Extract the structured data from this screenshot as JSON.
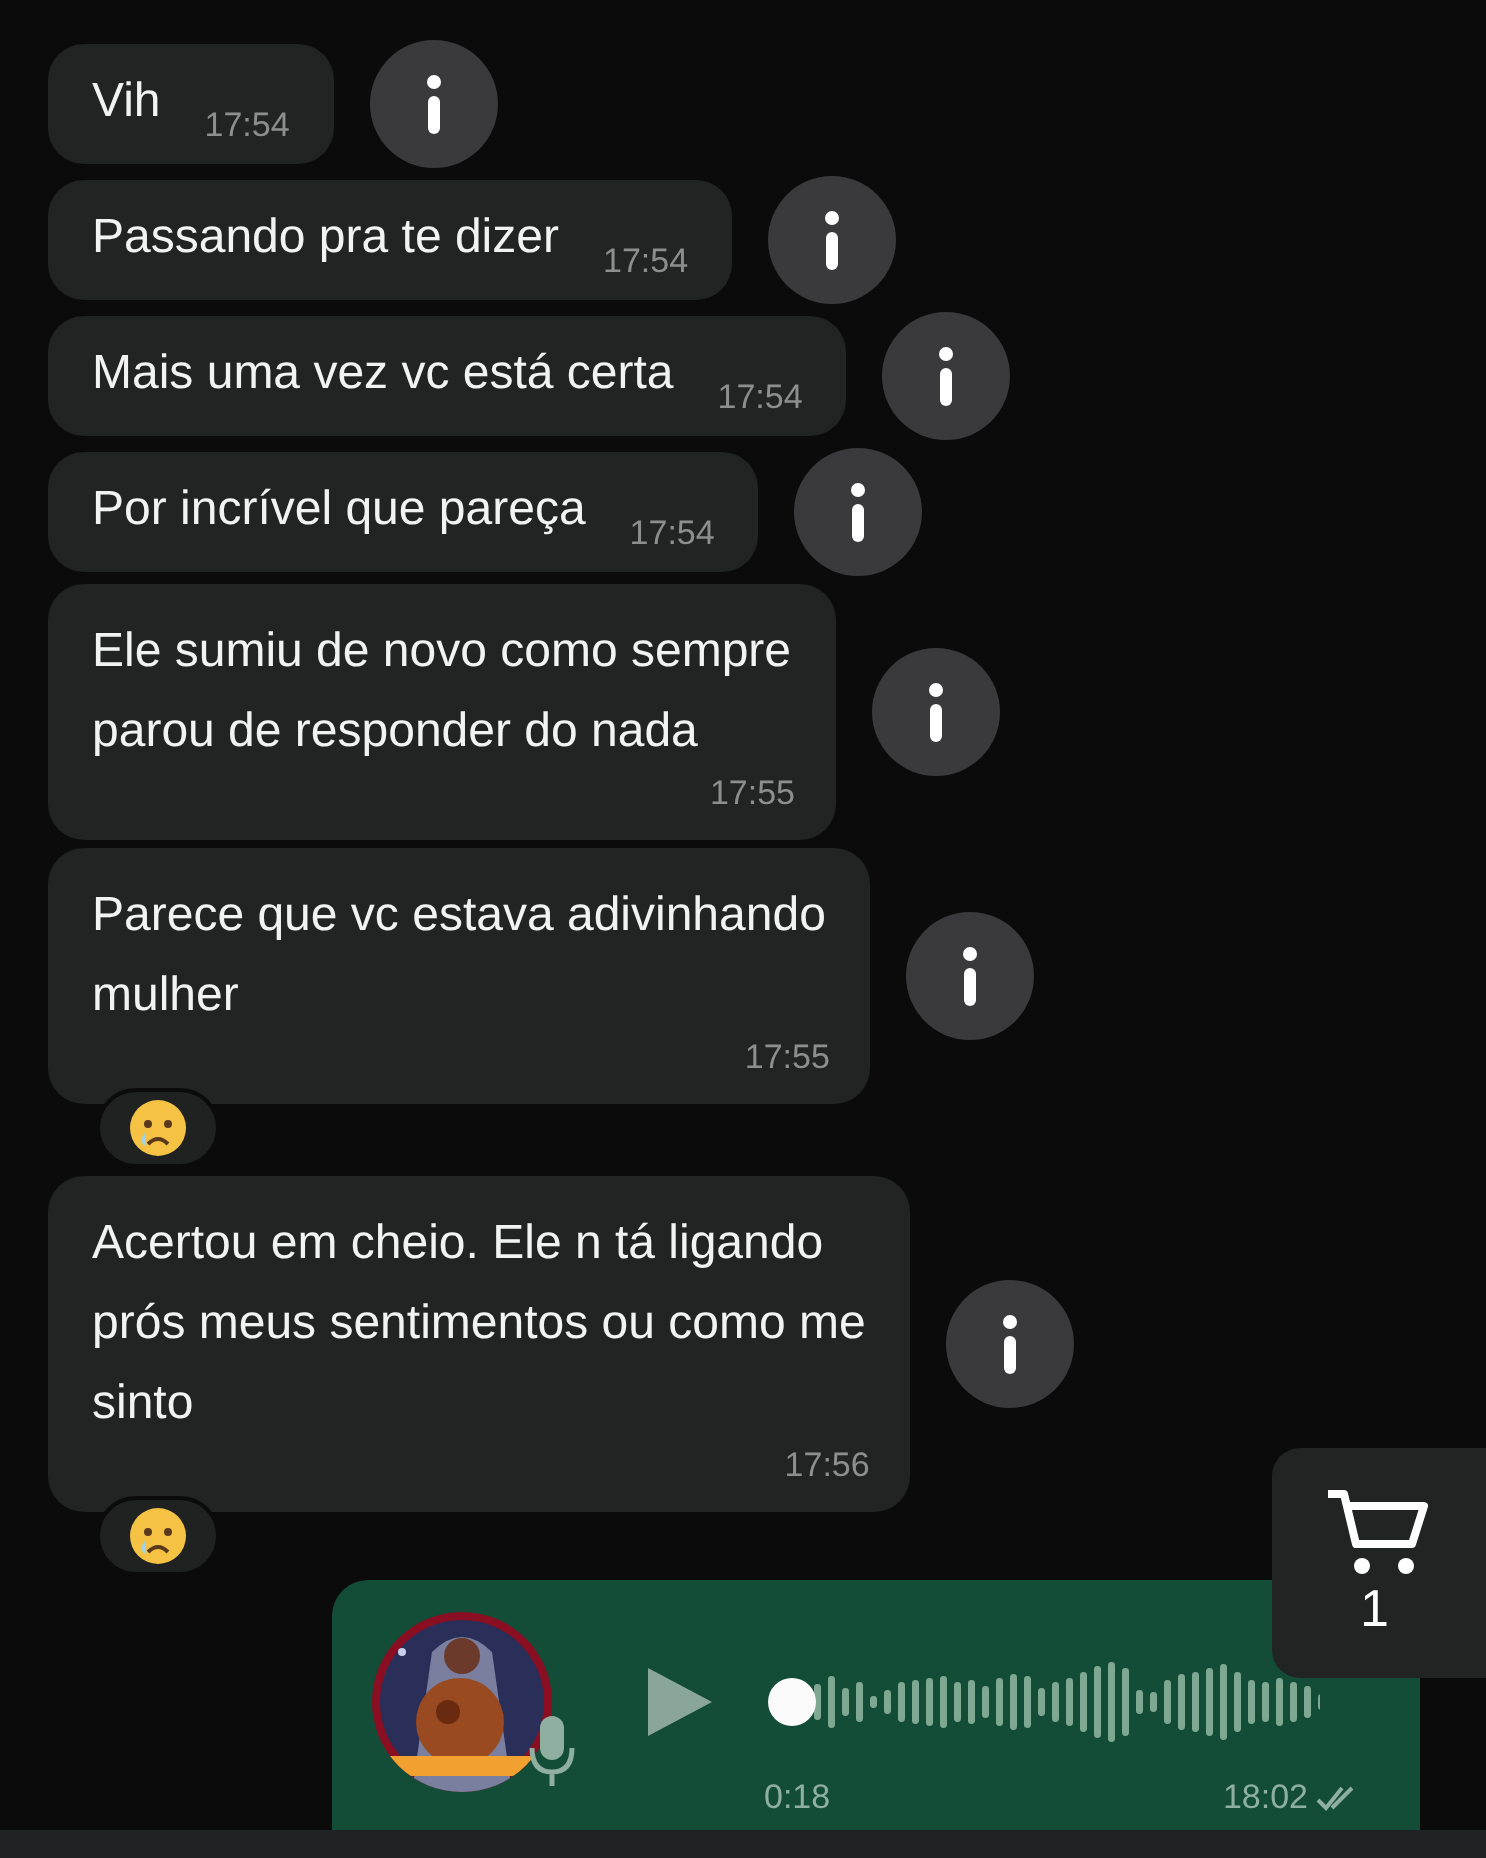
{
  "messages": [
    {
      "lines": [
        "Vih"
      ],
      "time": "17:54",
      "reaction": false
    },
    {
      "lines": [
        "Passando pra te dizer"
      ],
      "time": "17:54",
      "reaction": false
    },
    {
      "lines": [
        "Mais uma vez vc está certa"
      ],
      "time": "17:54",
      "reaction": false
    },
    {
      "lines": [
        "Por incrível que pareça"
      ],
      "time": "17:54",
      "reaction": false
    },
    {
      "lines": [
        "Ele sumiu de novo como sempre",
        "parou de responder do nada"
      ],
      "time": "17:55",
      "reaction": false
    },
    {
      "lines": [
        "Parece que vc estava adivinhando",
        "mulher"
      ],
      "time": "17:55",
      "reaction": true
    },
    {
      "lines": [
        "Acertou em cheio. Ele n tá ligando",
        "prós meus sentimentos ou como me",
        "sinto"
      ],
      "time": "17:56",
      "reaction": true
    }
  ],
  "voice_message": {
    "duration": "0:18",
    "time": "18:02",
    "read": true,
    "level": 0.0
  },
  "cart": {
    "count": "1"
  }
}
